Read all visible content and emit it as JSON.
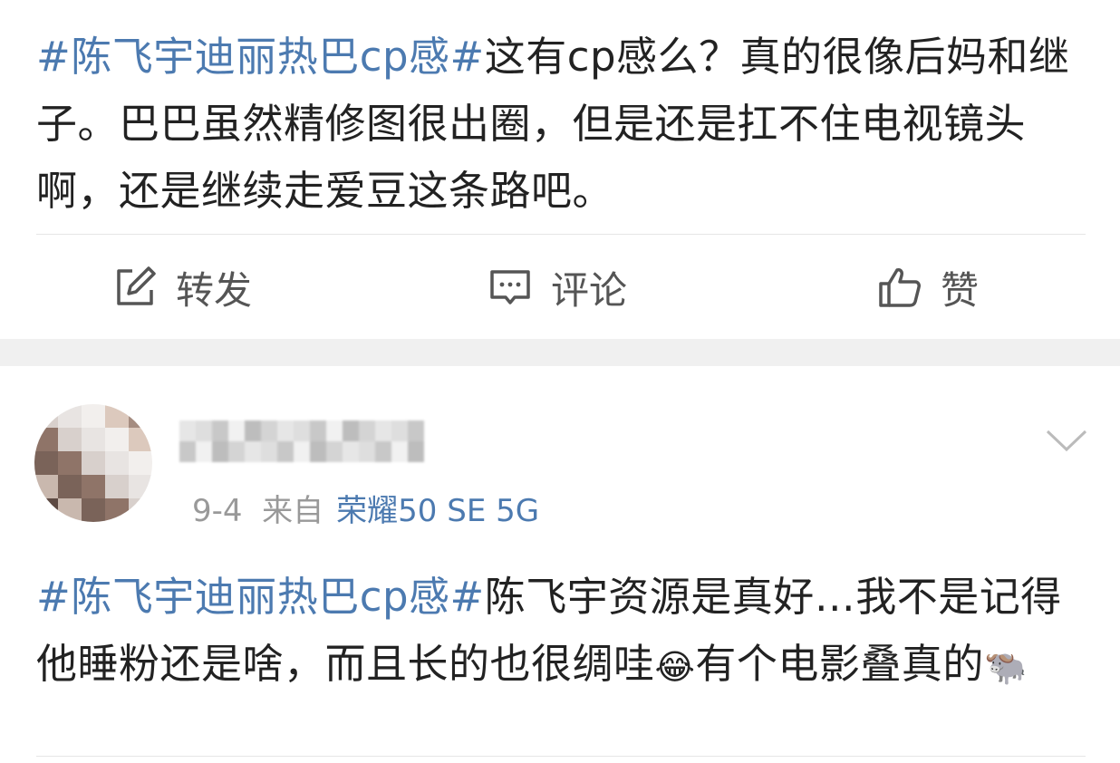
{
  "post1": {
    "tag": "#陈飞宇迪丽热巴cp感#",
    "body": "这有cp感么？真的很像后妈和继子。巴巴虽然精修图很出圈，但是还是扛不住电视镜头啊，还是继续走爱豆这条路吧。",
    "actions": {
      "repost": "转发",
      "comment": "评论",
      "like": "赞"
    }
  },
  "post2": {
    "date": "9-4",
    "source_label": "来自",
    "device": "荣耀50 SE 5G",
    "tag": "#陈飞宇迪丽热巴cp感#",
    "body_part1": "陈飞宇资源是真好…我不是记得他睡粉还是啥，而且长的也很绸哇",
    "emoji1": "😂",
    "body_part2": "有个电影叠真的",
    "emoji2": "🐃"
  },
  "colors": {
    "link": "#4c7ab0",
    "text": "#222222",
    "muted": "#999999",
    "divider": "#e6e6e6",
    "gap": "#f0f0f0"
  },
  "icons": [
    "repost-icon",
    "comment-icon",
    "like-icon",
    "chevron-down-icon"
  ]
}
